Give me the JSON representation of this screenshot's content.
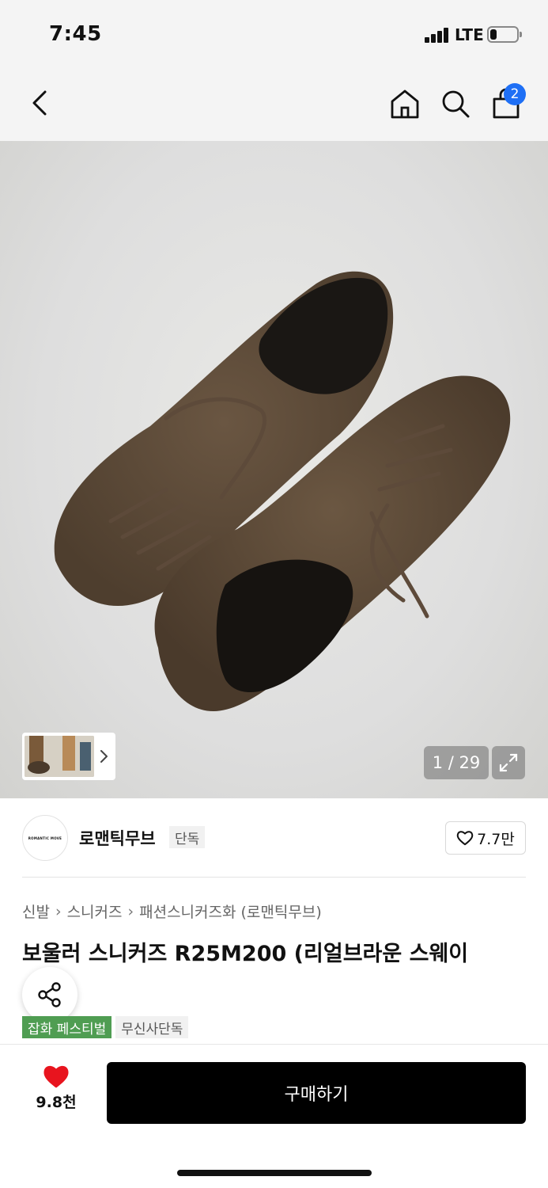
{
  "status_bar": {
    "time": "7:45",
    "network": "LTE",
    "battery_level": 0.25
  },
  "nav": {
    "back_icon": "chevron-left-icon",
    "home_icon": "home-icon",
    "search_icon": "search-icon",
    "cart_icon": "shopping-bag-icon",
    "cart_count": "2"
  },
  "gallery": {
    "counter": "1 / 29",
    "expand_icon": "expand-icon"
  },
  "brand": {
    "logo_text": "ROMANTIC MOVE",
    "name": "로맨틱무브",
    "exclusive_tag": "단독",
    "likes": "7.7만"
  },
  "product": {
    "breadcrumb": [
      "신발",
      "스니커즈",
      "패션스니커즈화 (로맨틱무브)"
    ],
    "title": "보울러 스니커즈 R25M200 (리얼브라운 스웨이",
    "tags": [
      "잡화 페스티벌",
      "무신사단독"
    ]
  },
  "bottom": {
    "wish_count": "9.8천",
    "buy_label": "구매하기"
  },
  "colors": {
    "cart_badge": "#1e6ff5",
    "festival_tag": "#4f9d52",
    "heart": "#e8141e",
    "buy_button": "#000000"
  }
}
